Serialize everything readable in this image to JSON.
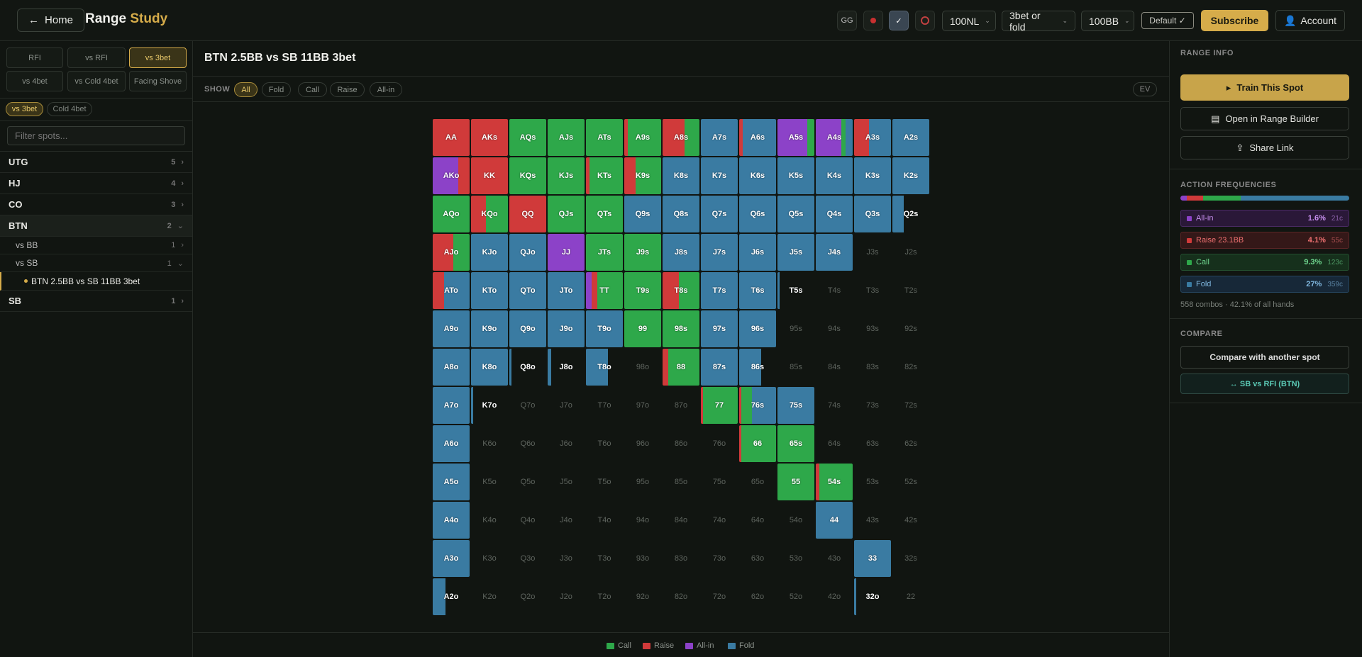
{
  "header": {
    "home_label": "Home",
    "title_main": "Range",
    "title_accent": "Study",
    "stakes": "100NL",
    "mode": "3bet or fold",
    "stack": "100BB",
    "default_label": "Default",
    "subscribe_label": "Subscribe",
    "account_label": "Account",
    "icons": [
      "gg-icon",
      "red-dot-icon",
      "check-brand-icon",
      "chip-icon"
    ]
  },
  "sidebar": {
    "position_tabs": [
      "RFI",
      "vs RFI",
      "vs 3bet",
      "vs 4bet",
      "vs Cold 4bet",
      "Facing Shove"
    ],
    "active_position_tab": 2,
    "sub_tabs": [
      "vs 3bet",
      "Cold 4bet"
    ],
    "filter_placeholder": "Filter spots...",
    "groups": [
      {
        "name": "UTG",
        "count": "5"
      },
      {
        "name": "HJ",
        "count": "4"
      },
      {
        "name": "CO",
        "count": "3"
      },
      {
        "name": "BTN",
        "count": "2"
      },
      {
        "name": "vs BB",
        "count": "1"
      },
      {
        "name": "vs SB",
        "count": "1"
      },
      {
        "name": "BTN 2.5BB vs SB 11BB 3bet",
        "count": ""
      },
      {
        "name": "SB",
        "count": "1"
      }
    ]
  },
  "main": {
    "title": "BTN 2.5BB vs SB 11BB 3bet",
    "show_label": "SHOW",
    "filters": [
      "All",
      "Fold",
      "Call",
      "Raise",
      "All-in"
    ],
    "ev_label": "EV",
    "legend": [
      "Call",
      "Raise",
      "All-in",
      "Fold"
    ]
  },
  "colors": {
    "call": "#2ea84a",
    "raise": "#d03a3a",
    "allin": "#8c42c8",
    "fold": "#3a7ba2",
    "accent": "#d6ac4a"
  },
  "chart_data": {
    "type": "heatmap",
    "ranks": [
      "A",
      "K",
      "Q",
      "J",
      "T",
      "9",
      "8",
      "7",
      "6",
      "5",
      "4",
      "3",
      "2"
    ],
    "hands": [
      [
        "AA",
        "AKs",
        "AQs",
        "AJs",
        "ATs",
        "A9s",
        "A8s",
        "A7s",
        "A6s",
        "A5s",
        "A4s",
        "A3s",
        "A2s"
      ],
      [
        "AKo",
        "KK",
        "KQs",
        "KJs",
        "KTs",
        "K9s",
        "K8s",
        "K7s",
        "K6s",
        "K5s",
        "K4s",
        "K3s",
        "K2s"
      ],
      [
        "AQo",
        "KQo",
        "QQ",
        "QJs",
        "QTs",
        "Q9s",
        "Q8s",
        "Q7s",
        "Q6s",
        "Q5s",
        "Q4s",
        "Q3s",
        "Q2s"
      ],
      [
        "AJo",
        "KJo",
        "QJo",
        "JJ",
        "JTs",
        "J9s",
        "J8s",
        "J7s",
        "J6s",
        "J5s",
        "J4s",
        "J3s",
        "J2s"
      ],
      [
        "ATo",
        "KTo",
        "QTo",
        "JTo",
        "TT",
        "T9s",
        "T8s",
        "T7s",
        "T6s",
        "T5s",
        "T4s",
        "T3s",
        "T2s"
      ],
      [
        "A9o",
        "K9o",
        "Q9o",
        "J9o",
        "T9o",
        "99",
        "98s",
        "97s",
        "96s",
        "95s",
        "94s",
        "93s",
        "92s"
      ],
      [
        "A8o",
        "K8o",
        "Q8o",
        "J8o",
        "T8o",
        "98o",
        "88",
        "87s",
        "86s",
        "85s",
        "84s",
        "83s",
        "82s"
      ],
      [
        "A7o",
        "K7o",
        "Q7o",
        "J7o",
        "T7o",
        "97o",
        "87o",
        "77",
        "76s",
        "75s",
        "74s",
        "73s",
        "72s"
      ],
      [
        "A6o",
        "K6o",
        "Q6o",
        "J6o",
        "T6o",
        "96o",
        "86o",
        "76o",
        "66",
        "65s",
        "64s",
        "63s",
        "62s"
      ],
      [
        "A5o",
        "K5o",
        "Q5o",
        "J5o",
        "T5o",
        "95o",
        "85o",
        "75o",
        "65o",
        "55",
        "54s",
        "53s",
        "52s"
      ],
      [
        "A4o",
        "K4o",
        "Q4o",
        "J4o",
        "T4o",
        "94o",
        "84o",
        "74o",
        "64o",
        "54o",
        "44",
        "43s",
        "42s"
      ],
      [
        "A3o",
        "K3o",
        "Q3o",
        "J3o",
        "T3o",
        "93o",
        "83o",
        "73o",
        "63o",
        "53o",
        "43o",
        "33",
        "32s"
      ],
      [
        "A2o",
        "K2o",
        "Q2o",
        "J2o",
        "T2o",
        "92o",
        "82o",
        "72o",
        "62o",
        "52o",
        "42o",
        "32o",
        "22"
      ]
    ],
    "frequencies": [
      [
        {
          "raise": 1
        },
        {
          "raise": 1
        },
        {
          "call": 1
        },
        {
          "call": 1
        },
        {
          "call": 1
        },
        {
          "raise": 0.1,
          "call": 0.9
        },
        {
          "raise": 0.6,
          "call": 0.4
        },
        {
          "fold": 1
        },
        {
          "raise": 0.1,
          "fold": 0.9
        },
        {
          "allin": 0.8,
          "call": 0.2
        },
        {
          "allin": 0.7,
          "call": 0.1,
          "fold": 0.2
        },
        {
          "raise": 0.4,
          "fold": 0.6
        },
        {
          "fold": 1
        }
      ],
      [
        {
          "allin": 0.7,
          "raise": 0.3
        },
        {
          "raise": 1
        },
        {
          "call": 1
        },
        {
          "call": 1
        },
        {
          "raise": 0.1,
          "call": 0.9
        },
        {
          "raise": 0.3,
          "call": 0.7
        },
        {
          "fold": 1
        },
        {
          "fold": 1
        },
        {
          "fold": 1
        },
        {
          "fold": 1
        },
        {
          "fold": 1
        },
        {
          "fold": 1
        },
        {
          "fold": 1
        }
      ],
      [
        {
          "call": 1
        },
        {
          "raise": 0.4,
          "call": 0.6
        },
        {
          "raise": 1
        },
        {
          "call": 1
        },
        {
          "call": 1
        },
        {
          "fold": 1
        },
        {
          "fold": 1
        },
        {
          "fold": 1
        },
        {
          "fold": 1
        },
        {
          "fold": 1
        },
        {
          "fold": 1
        },
        {
          "fold": 1
        },
        {
          "fold": 0.3
        }
      ],
      [
        {
          "raise": 0.55,
          "call": 0.45
        },
        {
          "fold": 1
        },
        {
          "fold": 1
        },
        {
          "allin": 1
        },
        {
          "call": 1
        },
        {
          "call": 1
        },
        {
          "fold": 1
        },
        {
          "fold": 1
        },
        {
          "fold": 1
        },
        {
          "fold": 1
        },
        {
          "fold": 1
        },
        {},
        {}
      ],
      [
        {
          "raise": 0.3,
          "fold": 0.7
        },
        {
          "fold": 1
        },
        {
          "fold": 1
        },
        {
          "fold": 1
        },
        {
          "allin": 0.15,
          "raise": 0.15,
          "call": 0.7
        },
        {
          "call": 1
        },
        {
          "raise": 0.45,
          "call": 0.55
        },
        {
          "fold": 1
        },
        {
          "fold": 1
        },
        {
          "fold": 0.05
        },
        {},
        {},
        {}
      ],
      [
        {
          "fold": 1
        },
        {
          "fold": 1
        },
        {
          "fold": 1
        },
        {
          "fold": 1
        },
        {
          "fold": 1
        },
        {
          "call": 1
        },
        {
          "call": 1
        },
        {
          "fold": 1
        },
        {
          "fold": 1
        },
        {},
        {},
        {},
        {}
      ],
      [
        {
          "fold": 1
        },
        {
          "fold": 1
        },
        {
          "fold": 0.05
        },
        {
          "fold": 0.1
        },
        {
          "fold": 0.6
        },
        {},
        {
          "raise": 0.15,
          "call": 0.85
        },
        {
          "fold": 1
        },
        {
          "fold": 0.6
        },
        {},
        {},
        {},
        {}
      ],
      [
        {
          "fold": 1
        },
        {
          "fold": 0.05
        },
        {},
        {},
        {},
        {},
        {},
        {
          "raise": 0.05,
          "call": 0.95
        },
        {
          "raise": 0.05,
          "call": 0.3,
          "fold": 0.65
        },
        {
          "fold": 1
        },
        {},
        {},
        {}
      ],
      [
        {
          "fold": 1
        },
        {},
        {},
        {},
        {},
        {},
        {},
        {},
        {
          "raise": 0.05,
          "call": 0.95
        },
        {
          "call": 1
        },
        {},
        {},
        {}
      ],
      [
        {
          "fold": 1
        },
        {},
        {},
        {},
        {},
        {},
        {},
        {},
        {},
        {
          "call": 1
        },
        {
          "raise": 0.1,
          "call": 0.9
        },
        {},
        {}
      ],
      [
        {
          "fold": 1
        },
        {},
        {},
        {},
        {},
        {},
        {},
        {},
        {},
        {},
        {
          "fold": 1
        },
        {},
        {}
      ],
      [
        {
          "fold": 1
        },
        {},
        {},
        {},
        {},
        {},
        {},
        {},
        {},
        {},
        {},
        {
          "fold": 1
        },
        {}
      ],
      [
        {
          "fold": 0.35
        },
        {},
        {},
        {},
        {},
        {},
        {},
        {},
        {},
        {},
        {},
        {
          "fold": 0.05
        },
        {}
      ]
    ]
  },
  "right_panel": {
    "range_info_label": "RANGE INFO",
    "train_label": "Train This Spot",
    "open_builder_label": "Open in Range Builder",
    "share_label": "Share Link",
    "action_freq_label": "ACTION FREQUENCIES",
    "actions": [
      {
        "name": "All-in",
        "pct": "1.6%",
        "combos": "21c",
        "key": "allin"
      },
      {
        "name": "Raise 23.1BB",
        "pct": "4.1%",
        "combos": "55c",
        "key": "raise"
      },
      {
        "name": "Call",
        "pct": "9.3%",
        "combos": "123c",
        "key": "call"
      },
      {
        "name": "Fold",
        "pct": "27%",
        "combos": "359c",
        "key": "fold"
      }
    ],
    "combos_summary": "558 combos · 42.1% of all hands",
    "compare_label": "COMPARE",
    "compare_button": "Compare with another spot",
    "sb_rfi_link": "↔ SB vs RFI (BTN)"
  }
}
